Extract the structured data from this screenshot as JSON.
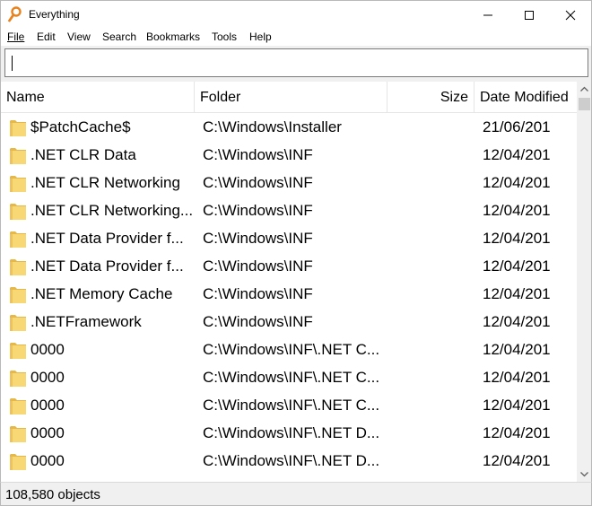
{
  "window": {
    "title": "Everything"
  },
  "menu": [
    {
      "label": "File"
    },
    {
      "label": "Edit"
    },
    {
      "label": "View"
    },
    {
      "label": "Search"
    },
    {
      "label": "Bookmarks"
    },
    {
      "label": "Tools"
    },
    {
      "label": "Help"
    }
  ],
  "search": {
    "value": "",
    "placeholder": ""
  },
  "columns": {
    "name": "Name",
    "folder": "Folder",
    "size": "Size",
    "date": "Date Modified"
  },
  "rows": [
    {
      "name": "$PatchCache$",
      "folder": "C:\\Windows\\Installer",
      "date": "21/06/201"
    },
    {
      "name": ".NET CLR Data",
      "folder": "C:\\Windows\\INF",
      "date": "12/04/201"
    },
    {
      "name": ".NET CLR Networking",
      "folder": "C:\\Windows\\INF",
      "date": "12/04/201"
    },
    {
      "name": ".NET CLR Networking...",
      "folder": "C:\\Windows\\INF",
      "date": "12/04/201"
    },
    {
      "name": ".NET Data Provider f...",
      "folder": "C:\\Windows\\INF",
      "date": "12/04/201"
    },
    {
      "name": ".NET Data Provider f...",
      "folder": "C:\\Windows\\INF",
      "date": "12/04/201"
    },
    {
      "name": ".NET Memory Cache",
      "folder": "C:\\Windows\\INF",
      "date": "12/04/201"
    },
    {
      "name": ".NETFramework",
      "folder": "C:\\Windows\\INF",
      "date": "12/04/201"
    },
    {
      "name": "0000",
      "folder": "C:\\Windows\\INF\\.NET C...",
      "date": "12/04/201"
    },
    {
      "name": "0000",
      "folder": "C:\\Windows\\INF\\.NET C...",
      "date": "12/04/201"
    },
    {
      "name": "0000",
      "folder": "C:\\Windows\\INF\\.NET C...",
      "date": "12/04/201"
    },
    {
      "name": "0000",
      "folder": "C:\\Windows\\INF\\.NET D...",
      "date": "12/04/201"
    },
    {
      "name": "0000",
      "folder": "C:\\Windows\\INF\\.NET D...",
      "date": "12/04/201"
    },
    {
      "name": "",
      "folder": "",
      "date": ""
    }
  ],
  "status": {
    "text": "108,580 objects"
  },
  "icons": {
    "app": "magnifier-icon",
    "folder": "folder-icon"
  },
  "colors": {
    "folder": "#f8d775",
    "folder_dark": "#e6b84a",
    "app_icon": "#e8821e"
  }
}
